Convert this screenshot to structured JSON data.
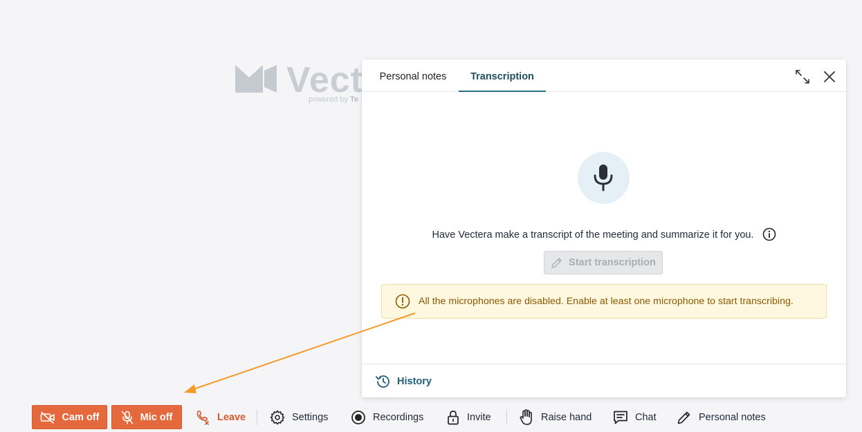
{
  "logo": {
    "word": "Vecte",
    "powered_prefix": "powered by ",
    "powered_brand": "Te"
  },
  "panel": {
    "tabs": [
      {
        "label": "Personal notes",
        "active": false
      },
      {
        "label": "Transcription",
        "active": true
      }
    ],
    "expand_icon": "expand-icon",
    "close_icon": "close-icon",
    "intro_text": "Have Vectera make a transcript of the meeting and summarize it for you.",
    "start_button": "Start transcription",
    "warning": "All the microphones are disabled. Enable at least one microphone to start transcribing.",
    "history": "History"
  },
  "toolbar": {
    "cam": "Cam off",
    "mic": "Mic off",
    "leave": "Leave",
    "settings": "Settings",
    "recordings": "Recordings",
    "invite": "Invite",
    "raise_hand": "Raise hand",
    "chat": "Chat",
    "personal_notes": "Personal notes"
  },
  "colors": {
    "accent_orange": "#e46a3e",
    "teal": "#2a6f8a",
    "warning_bg": "#fff8e1",
    "annotation_arrow": "#f59a2a"
  }
}
